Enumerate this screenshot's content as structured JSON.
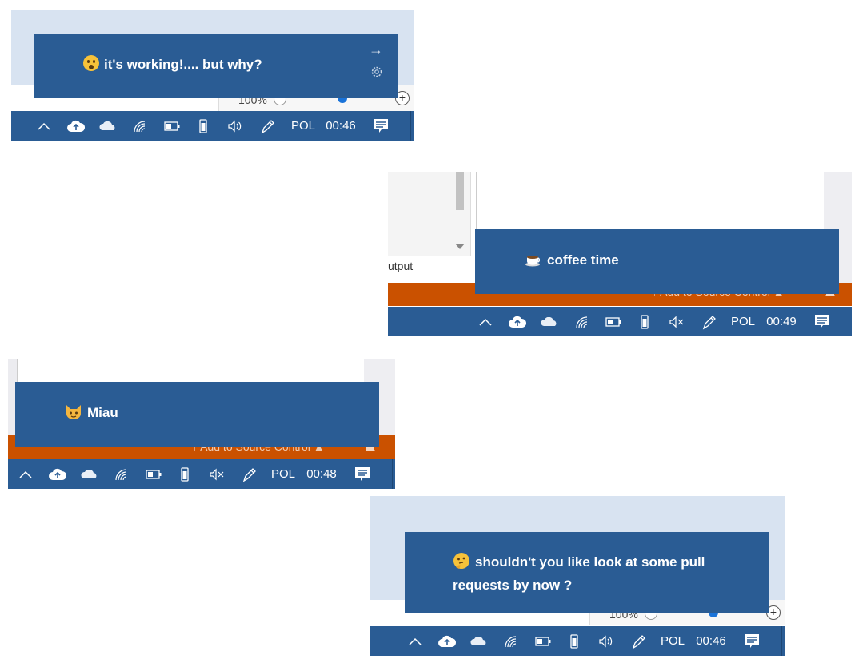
{
  "colors": {
    "taskbar": "#2a5c94",
    "toast": "#2a5c94",
    "orange": "#ca5100",
    "light_bg": "#d8e3f1"
  },
  "taskbar_icons": [
    "chevron-up-icon",
    "cloud-upload-icon",
    "onedrive-cloud-icon",
    "wifi-icon",
    "battery-icon",
    "phone-icon",
    "speaker-icon",
    "pen-icon",
    "language-indicator",
    "clock",
    "action-center-icon"
  ],
  "shots": [
    {
      "toast_text": "it's working!.... but why?",
      "emoji": "astonished",
      "language": "POL",
      "time": "00:46",
      "zoom": "100%",
      "volume": "on"
    },
    {
      "toast_text": "coffee time",
      "emoji": "hot-beverage",
      "language": "POL",
      "time": "00:49",
      "output_label": "utput",
      "source_control": "Add to Source Control",
      "volume": "muted"
    },
    {
      "toast_text": "Miau",
      "emoji": "cat-face",
      "language": "POL",
      "time": "00:48",
      "source_control": "Add to Source Control",
      "volume": "muted"
    },
    {
      "toast_text_line1": "shouldn't you like look at some pull",
      "toast_text_line2": "requests by now ?",
      "emoji": "thinking",
      "language": "POL",
      "time": "00:46",
      "zoom": "100%",
      "volume": "on"
    }
  ]
}
